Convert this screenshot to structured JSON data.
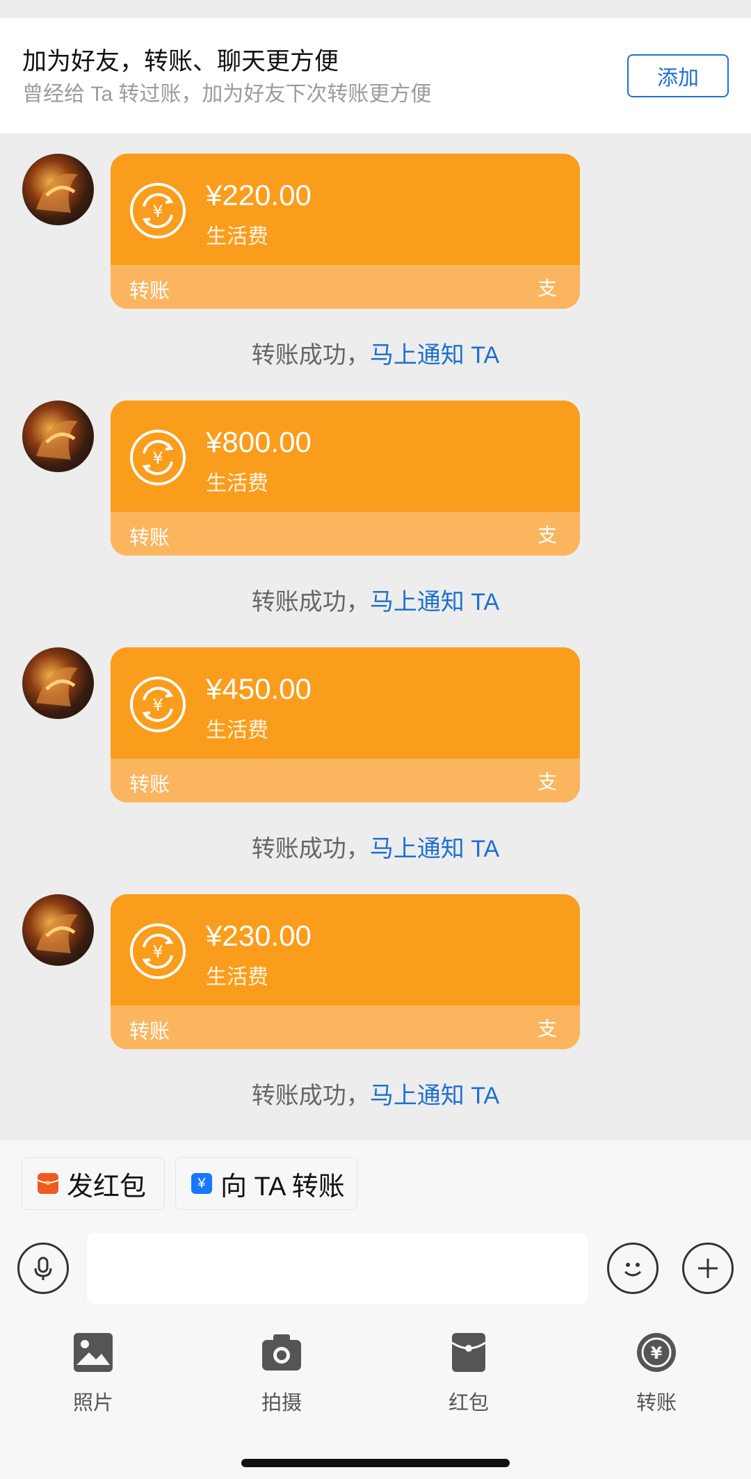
{
  "banner": {
    "title": "加为好友，转账、聊天更方便",
    "subtitle": "曾经给 Ta 转过账，加为好友下次转账更方便",
    "add_button": "添加"
  },
  "messages": [
    {
      "amount": "¥220.00",
      "memo": "生活费",
      "type": "转账",
      "status": "转账成功，",
      "status_link": "马上通知 TA"
    },
    {
      "amount": "¥800.00",
      "memo": "生活费",
      "type": "转账",
      "status": "转账成功，",
      "status_link": "马上通知 TA"
    },
    {
      "amount": "¥450.00",
      "memo": "生活费",
      "type": "转账",
      "status": "转账成功，",
      "status_link": "马上通知 TA"
    },
    {
      "amount": "¥230.00",
      "memo": "生活费",
      "type": "转账",
      "status": "转账成功，",
      "status_link": "马上通知 TA"
    }
  ],
  "quick_actions": [
    {
      "label": "发红包",
      "icon": "red-packet-icon",
      "color": "#f05a1e"
    },
    {
      "label": "向 TA 转账",
      "icon": "transfer-icon",
      "color": "#1677ff"
    }
  ],
  "toolbar": [
    {
      "label": "照片",
      "icon": "photo-icon"
    },
    {
      "label": "拍摄",
      "icon": "camera-icon"
    },
    {
      "label": "红包",
      "icon": "red-packet-icon"
    },
    {
      "label": "转账",
      "icon": "transfer-icon"
    }
  ],
  "colors": {
    "card_top": "#fa9d1c",
    "card_bottom": "#fbb55f",
    "link": "#1e6fd0",
    "background": "#ededed"
  }
}
